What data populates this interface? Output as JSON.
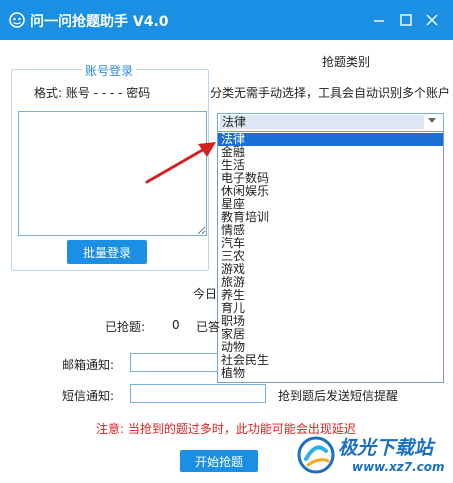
{
  "window": {
    "title": "问一问抢题助手 V4.0",
    "accent": "#1a8fe3"
  },
  "account_login": {
    "legend": "账号登录",
    "format_label": "格式: 账号 - - - - 密码",
    "batch_login_label": "批量登录"
  },
  "category": {
    "title": "抢题类别",
    "hint": "分类无需手动选择，工具会自动识别多个账户",
    "selected": "法律",
    "options": [
      "法律",
      "金融",
      "生活",
      "电子数码",
      "休闲娱乐",
      "星座",
      "教育培训",
      "情感",
      "汽车",
      "三农",
      "游戏",
      "旅游",
      "养生",
      "育儿",
      "职场",
      "家居",
      "动物",
      "社会民生",
      "植物"
    ]
  },
  "stats": {
    "today_label": "今日",
    "grabbed_label": "已抢题:",
    "grabbed_value": "0",
    "answered_label": "已答"
  },
  "notify": {
    "email_label": "邮箱通知:",
    "sms_label": "短信通知:",
    "sms_hint": "抢到题后发送短信提醒"
  },
  "warning": "注意: 当抢到的题过多时，此功能可能会出现延迟",
  "start_label": "开始抢题",
  "watermark": {
    "name": "极光下载站",
    "domain": "www.xz7.com"
  }
}
